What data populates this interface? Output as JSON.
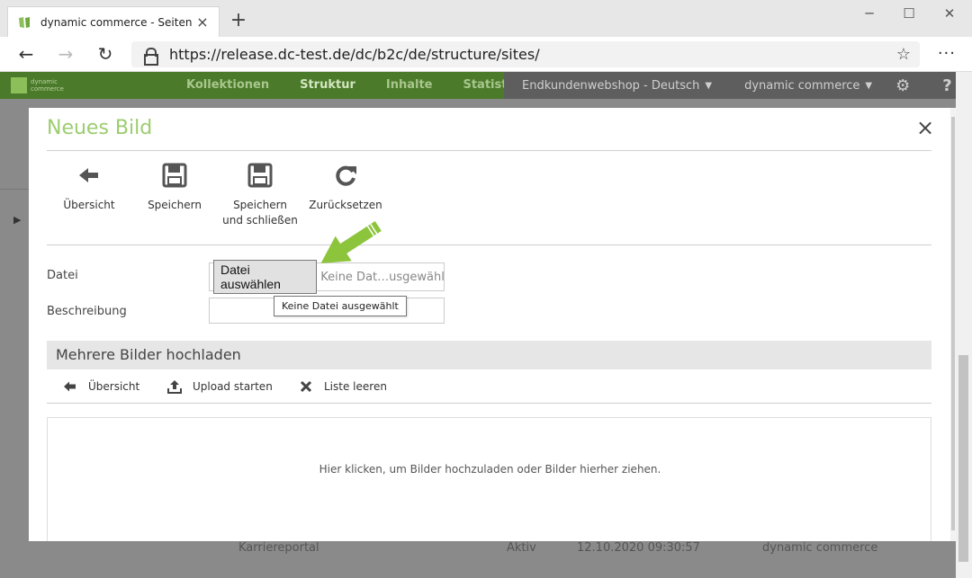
{
  "browser": {
    "tab_title": "dynamic commerce - Seiten",
    "tab_close": "×",
    "new_tab": "+",
    "minimize": "─",
    "maximize": "☐",
    "close": "✕",
    "back": "←",
    "forward": "→",
    "reload": "↻",
    "url": "https://release.dc-test.de/dc/b2c/de/structure/sites/",
    "favorite": "☆",
    "more": "···"
  },
  "app": {
    "logo_text": "dynamic commerce",
    "nav": [
      "Kollektionen",
      "Struktur",
      "Inhalte",
      "Statistik"
    ],
    "active_nav": "Struktur",
    "shop_selector": "Endkundenwebshop - Deutsch",
    "company_selector": "dynamic commerce",
    "caret": "▼",
    "settings_icon": "gear-icon",
    "help": "?"
  },
  "background": {
    "row": {
      "name": "Karriereportal",
      "status": "Aktiv",
      "date": "12.10.2020 09:30:57",
      "company": "dynamic commerce"
    }
  },
  "modal": {
    "title": "Neues Bild",
    "close": "×",
    "toolbar": [
      {
        "label": "Übersicht",
        "icon": "arrow-left-icon"
      },
      {
        "label": "Speichern",
        "icon": "save-icon"
      },
      {
        "label": "Speichern und schließen",
        "icon": "save-close-icon"
      },
      {
        "label": "Zurücksetzen",
        "icon": "reset-icon"
      }
    ],
    "form": {
      "file_label": "Datei",
      "file_button": "Datei auswählen",
      "file_status": "Keine Dat…usgewählt",
      "file_tooltip": "Keine Datei ausgewählt",
      "description_label": "Beschreibung",
      "description_value": ""
    },
    "multi_upload": {
      "title": "Mehrere Bilder hochladen",
      "toolbar": [
        {
          "label": "Übersicht",
          "icon": "arrow-left-icon"
        },
        {
          "label": "Upload starten",
          "icon": "upload-icon"
        },
        {
          "label": "Liste leeren",
          "icon": "clear-icon"
        }
      ],
      "dropzone_text": "Hier klicken, um Bilder hochzuladen oder Bilder hierher ziehen."
    }
  },
  "colors": {
    "accent_green": "#9ccd6f",
    "header_green": "#4b7a2a",
    "header_gray": "#5e5e5e",
    "pointer_arrow": "#8cc43c"
  }
}
